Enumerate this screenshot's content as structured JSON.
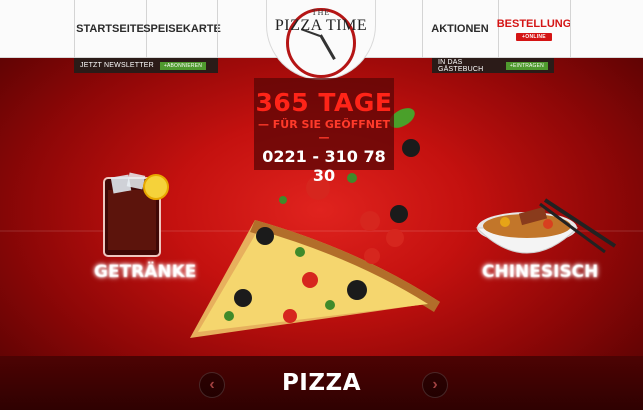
{
  "nav": {
    "startseite": "STARTSEITE",
    "speisekarte": "SPEISEKARTE",
    "aktionen": "AKTIONEN",
    "bestellung": "BESTELLUNG",
    "bestellung_badge": "+ONLINE"
  },
  "logo": {
    "the": "THE",
    "name": "PIZZA TIME"
  },
  "subbar": {
    "newsletter_label": "JETZT NEWSLETTER",
    "newsletter_button": "+ABONNIEREN",
    "guestbook_label": "IN DAS GÄSTEBUCH",
    "guestbook_button": "+EINTRAGEN"
  },
  "promo": {
    "days": "365 TAGE",
    "open": "— FÜR SIE GEÖFFNET —",
    "phone": "0221 - 310 78 30"
  },
  "categories": {
    "left": "GETRÄNKE",
    "right": "CHINESISCH"
  },
  "slider": {
    "current": "PIZZA",
    "prev_symbol": "‹",
    "next_symbol": "›"
  },
  "colors": {
    "accent_red": "#d41414",
    "green_button": "#4f9a2e",
    "background_red": "#c4110f"
  }
}
